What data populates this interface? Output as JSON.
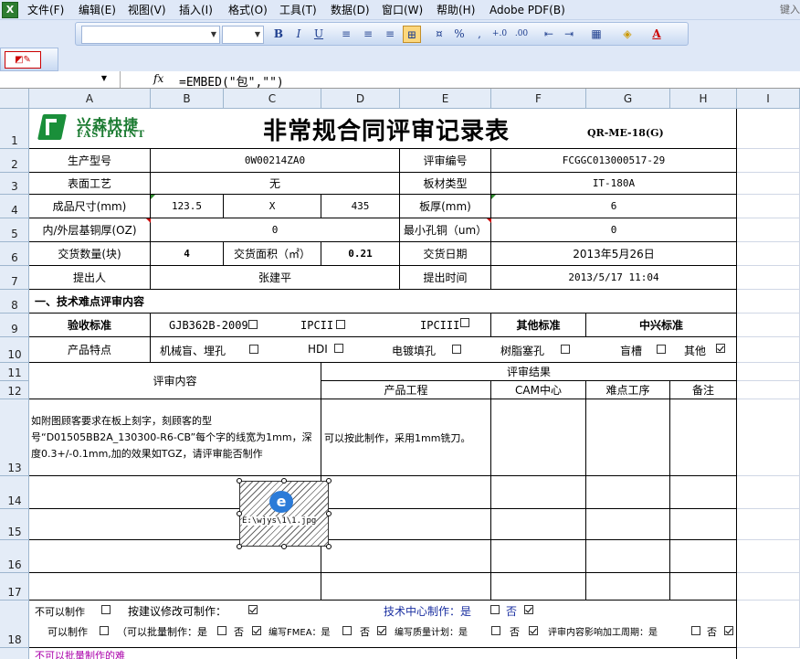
{
  "menu": {
    "items": [
      "文件(F)",
      "编辑(E)",
      "视图(V)",
      "插入(I)",
      "格式(O)",
      "工具(T)",
      "数据(D)",
      "窗口(W)",
      "帮助(H)",
      "Adobe PDF(B)"
    ],
    "help_box": "键入"
  },
  "toolbar": {
    "bold": "B",
    "italic": "I",
    "underline": "U",
    "percent": "%",
    "comma": ",",
    "font_color_letter": "A"
  },
  "formula_bar": {
    "fx": "fx",
    "formula": "=EMBED(\"包\",\"\")"
  },
  "columns": [
    "A",
    "B",
    "C",
    "D",
    "E",
    "F",
    "G",
    "H",
    "I"
  ],
  "rows": [
    "1",
    "2",
    "3",
    "4",
    "5",
    "6",
    "7",
    "8",
    "9",
    "10",
    "11",
    "12",
    "13",
    "14",
    "15",
    "16",
    "17",
    "18"
  ],
  "sheet": {
    "logo_cn": "兴森快捷",
    "logo_en": "FASTPRINT",
    "title": "非常规合同评审记录表",
    "doc_code": "QR-ME-18(G)",
    "r2": {
      "label1": "生产型号",
      "value1": "0W00214ZA0",
      "label2": "评审编号",
      "value2": "FCGGC013000517-29"
    },
    "r3": {
      "label1": "表面工艺",
      "value1": "无",
      "label2": "板材类型",
      "value2": "IT-180A"
    },
    "r4": {
      "label1": "成品尺寸(mm)",
      "w": "123.5",
      "x": "X",
      "h": "435",
      "label2": "板厚(mm)",
      "value2": "6"
    },
    "r5": {
      "label1": "内/外层基铜厚(OZ)",
      "value1": "0",
      "label2": "最小孔铜（um）",
      "value2": "0"
    },
    "r6": {
      "label1": "交货数量(块)",
      "qty": "4",
      "area_label": "交货面积（㎡）",
      "area": "0.21",
      "label2": "交货日期",
      "value2": "2013年5月26日"
    },
    "r7": {
      "label1": "提出人",
      "value1": "张建平",
      "label2": "提出时间",
      "value2": "2013/5/17  11:04"
    },
    "section8": "一、技术难点评审内容",
    "r9": {
      "label": "验收标准",
      "opt1": "GJB362B-2009",
      "opt2": "IPCII",
      "opt3": "IPCIII",
      "other_label": "其他标准",
      "other_value": "中兴标准"
    },
    "r10": {
      "label": "产品特点",
      "opt1": "机械盲、埋孔",
      "opt2": "HDI",
      "opt3": "电镀填孔",
      "opt4": "树脂塞孔",
      "opt5": "盲槽",
      "opt6": "其他"
    },
    "review_content_label": "评审内容",
    "review_result_label": "评审结果",
    "result_cols": [
      "产品工程",
      "CAM中心",
      "难点工序",
      "备注"
    ],
    "r13": {
      "content": "如附图顾客要求在板上刻字，刻顾客的型号“D01505BB2A_130300-R6-CB”每个字的线宽为1mm，深度0.3+/-0.1mm,加的效果如TGZ，请评审能否制作",
      "engineering": "可以按此制作，采用1mm铣刀。"
    },
    "embed_label": "E:\\wjys\\1\\1.jpg",
    "r18": {
      "cannot": "不可以制作",
      "suggest": "按建议修改可制作：",
      "tech_center": "技术中心制作：是",
      "no": "否",
      "can": "可以制作",
      "batch": "（可以批量制作：是",
      "fmea": "编写FMEA：是",
      "quality": "编写质量计划：是",
      "cycle": "评审内容影响加工周期：是"
    },
    "bottom_text": "不可以批量制作的难"
  }
}
